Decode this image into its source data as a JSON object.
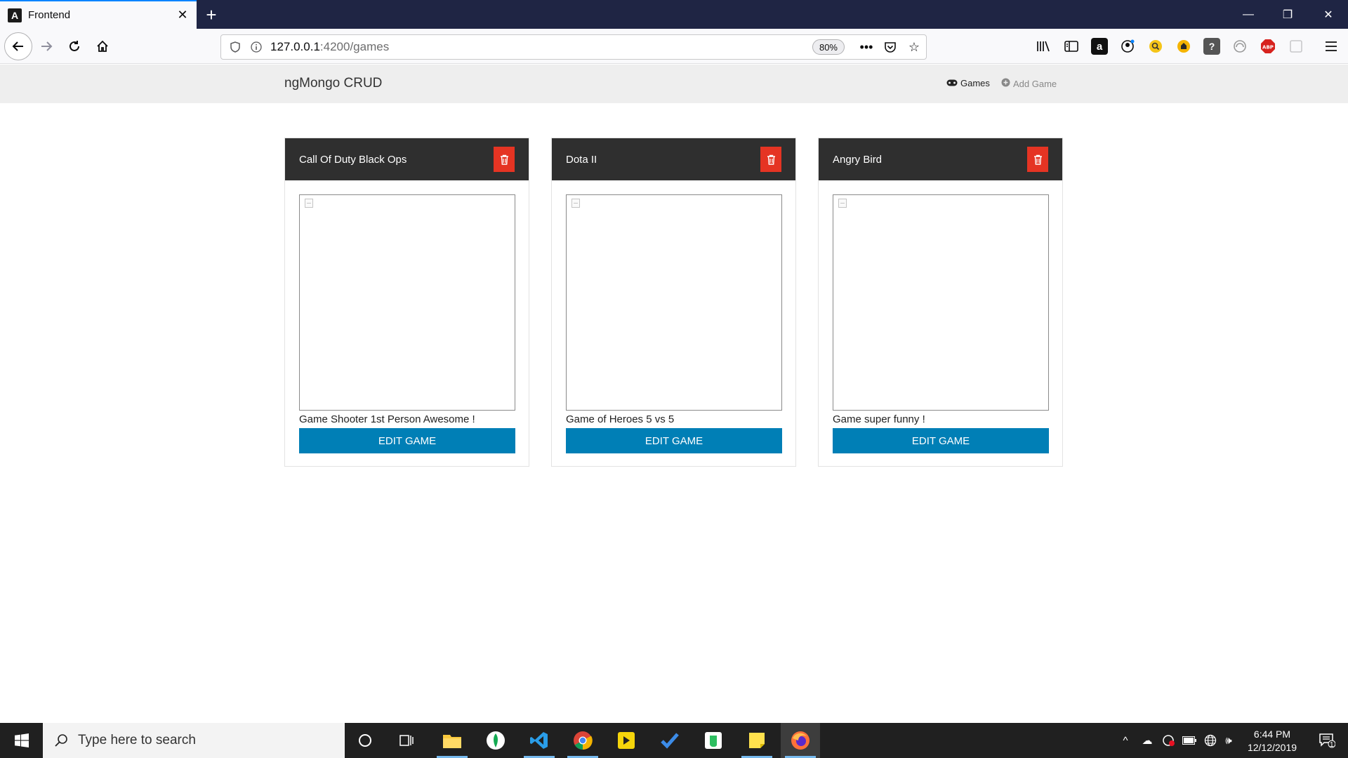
{
  "browser": {
    "tab_title": "Frontend",
    "tab_favicon": "A",
    "url_host": "127.0.0.1",
    "url_path": ":4200/games",
    "zoom": "80%"
  },
  "app": {
    "brand": "ngMongo CRUD",
    "nav": {
      "games": "Games",
      "add_game": "Add Game"
    }
  },
  "games": [
    {
      "title": "Call Of Duty Black Ops",
      "description": "Game Shooter 1st Person Awesome !",
      "edit_label": "EDIT GAME"
    },
    {
      "title": "Dota II",
      "description": "Game of Heroes 5 vs 5",
      "edit_label": "EDIT GAME"
    },
    {
      "title": "Angry Bird",
      "description": "Game super funny !",
      "edit_label": "EDIT GAME"
    }
  ],
  "taskbar": {
    "search_placeholder": "Type here to search",
    "time": "6:44 PM",
    "date": "12/12/2019",
    "notification_count": "1"
  },
  "colors": {
    "card_header": "#2f2f2f",
    "delete_button": "#e53423",
    "edit_button": "#007fb6",
    "app_header": "#eeeeee"
  }
}
